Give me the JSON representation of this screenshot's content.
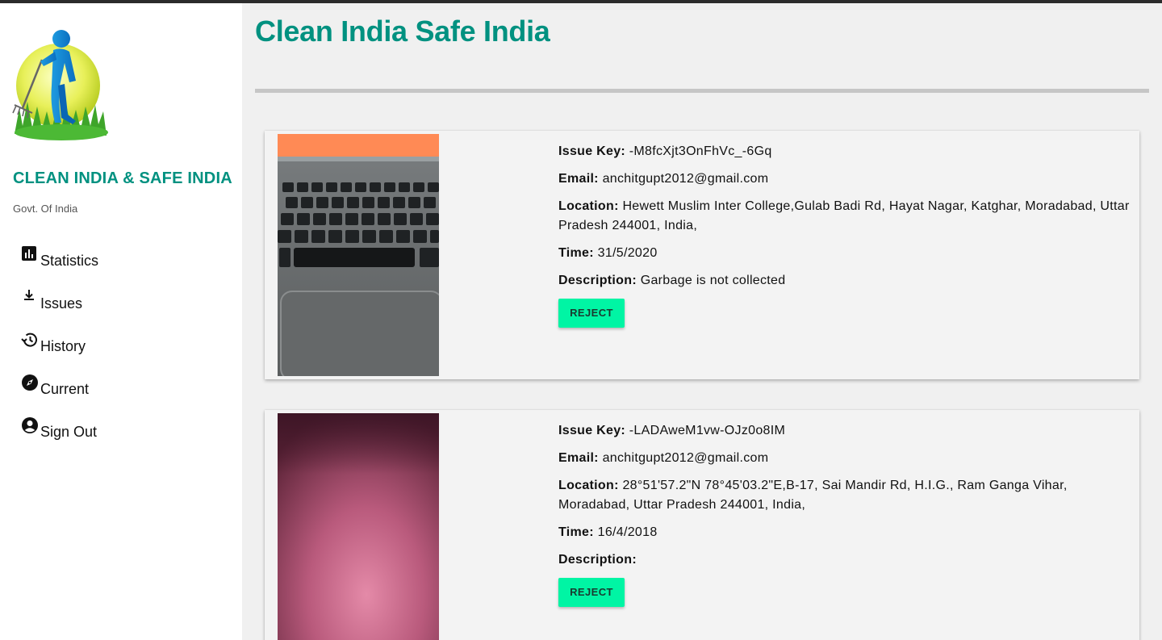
{
  "app": {
    "title": "Clean India Safe India",
    "brand_title": "CLEAN INDIA & SAFE INDIA",
    "brand_subtitle": "Govt. Of India",
    "accent_color": "#009180",
    "button_color": "#00f5a4"
  },
  "sidebar": {
    "items": [
      {
        "label": "Statistics",
        "icon": "bar-chart-icon"
      },
      {
        "label": "Issues",
        "icon": "download-icon"
      },
      {
        "label": "History",
        "icon": "history-icon"
      },
      {
        "label": "Current",
        "icon": "compass-icon"
      },
      {
        "label": "Sign Out",
        "icon": "account-circle-icon"
      }
    ]
  },
  "labels": {
    "issue_key": "Issue Key:",
    "email": "Email:",
    "location": "Location:",
    "time": "Time:",
    "description": "Description:",
    "reject": "REJECT"
  },
  "issues": [
    {
      "issue_key": "-M8fcXjt3OnFhVc_-6Gq",
      "email": "anchitgupt2012@gmail.com",
      "location": "Hewett Muslim Inter College,Gulab Badi Rd, Hayat Nagar, Katghar, Moradabad, Uttar Pradesh 244001, India,",
      "time": "31/5/2020",
      "description": "Garbage is not collected",
      "photo": "laptop-keyboard-photo"
    },
    {
      "issue_key": "-LADAweM1vw-OJz0o8IM",
      "email": "anchitgupt2012@gmail.com",
      "location": "28°51'57.2\"N 78°45'03.2\"E,B-17, Sai Mandir Rd, H.I.G., Ram Ganga Vihar, Moradabad, Uttar Pradesh 244001, India,",
      "time": "16/4/2018",
      "description": "",
      "photo": "pink-fabric-photo"
    }
  ]
}
